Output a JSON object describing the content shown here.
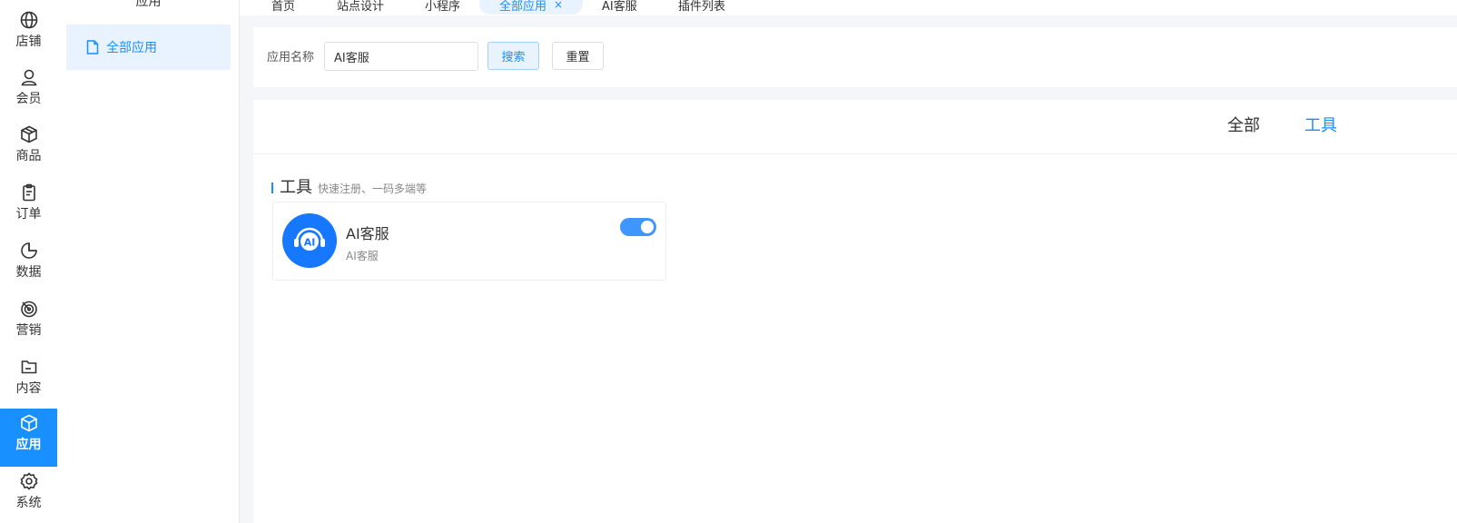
{
  "rail": {
    "items": [
      {
        "label": "店铺",
        "icon": "globe-icon"
      },
      {
        "label": "会员",
        "icon": "user-icon"
      },
      {
        "label": "商品",
        "icon": "box-icon"
      },
      {
        "label": "订单",
        "icon": "clipboard-icon"
      },
      {
        "label": "数据",
        "icon": "pie-chart-icon"
      },
      {
        "label": "营销",
        "icon": "target-icon"
      },
      {
        "label": "内容",
        "icon": "folder-icon"
      },
      {
        "label": "应用",
        "icon": "cube-icon",
        "active": true
      },
      {
        "label": "系统",
        "icon": "gear-icon"
      }
    ],
    "accent": "#1890ff"
  },
  "subsidebar": {
    "title": "应用",
    "items": [
      {
        "label": "全部应用",
        "icon": "document-icon",
        "active": true
      }
    ]
  },
  "tabs": [
    {
      "label": "首页"
    },
    {
      "label": "站点设计"
    },
    {
      "label": "小程序"
    },
    {
      "label": "全部应用",
      "active": true,
      "close": "×"
    },
    {
      "label": "AI客服"
    },
    {
      "label": "插件列表"
    }
  ],
  "search": {
    "label": "应用名称",
    "value": "AI客服",
    "search_button": "搜索",
    "reset_button": "重置"
  },
  "categories": [
    {
      "label": "全部"
    },
    {
      "label": "工具",
      "active": true
    }
  ],
  "section": {
    "title": "工具",
    "subtitle": "快速注册、一码多端等"
  },
  "apps": [
    {
      "name": "AI客服",
      "description": "AI客服",
      "logo_text": "AI",
      "enabled": true
    }
  ]
}
